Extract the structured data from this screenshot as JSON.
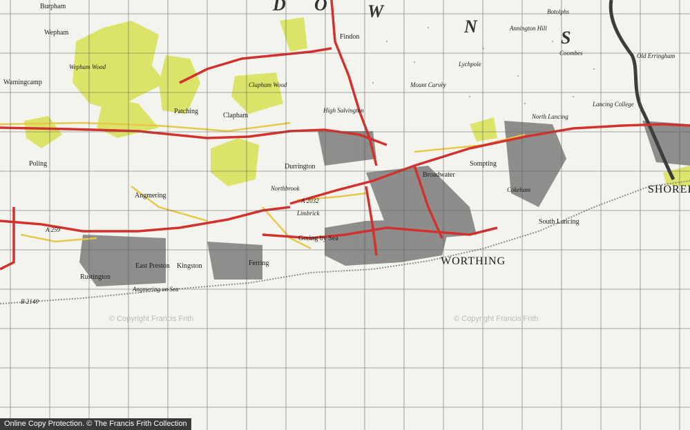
{
  "map": {
    "downs_letters": [
      "D",
      "O",
      "W",
      "N",
      "S"
    ],
    "towns": {
      "worthing": "WORTHING",
      "shoreham": "SHOREHAI"
    },
    "places": {
      "burpham": "Burpham",
      "wepham": "Wepham",
      "warningcamp": "Warningcamp",
      "wepham_wood": "Wepham Wood",
      "patching": "Patching",
      "clapham": "Clapham",
      "clapham_wood": "Clapham Wood",
      "findon": "Findon",
      "high_salvington": "High Salvington",
      "durrington": "Durrington",
      "northbrook": "Northbrook",
      "angmering": "Angmering",
      "poling": "Poling",
      "rustington": "Rustington",
      "east_preston": "East Preston",
      "kingston": "Kingston",
      "ferring": "Ferring",
      "goring_by_sea": "Goring by Sea",
      "limbrick": "Limbrick",
      "sompting": "Sompting",
      "broadwater": "Broadwater",
      "north_lancing": "North Lancing",
      "south_lancing": "South Lancing",
      "cokeham": "Cokeham",
      "coombes": "Coombes",
      "old_erringham": "Old Erringham",
      "annington_hill": "Annington Hill",
      "botolphs": "Botolphs",
      "mount_carvey": "Mount Carvey",
      "lychpole": "Lychpole",
      "angmering_on_sea": "Angmering on Sea",
      "lancing_college": "Lancing College"
    },
    "roads": {
      "a2032": "A 2032",
      "a259": "A 259",
      "b2140": "B 2140"
    },
    "watermarks": [
      "© Copyright Francis Frith",
      "© Copyright Francis Frith"
    ],
    "footer": "Online Copy Protection. © The Francis Frith Collection",
    "colors": {
      "background": "#f4f4ef",
      "woodland": "#d9e35a",
      "major_road": "#d2312e",
      "minor_road": "#e8c84c",
      "grid": "#5b5b5b",
      "river": "#3d3d3d",
      "urban": "#2c2c2c"
    }
  }
}
